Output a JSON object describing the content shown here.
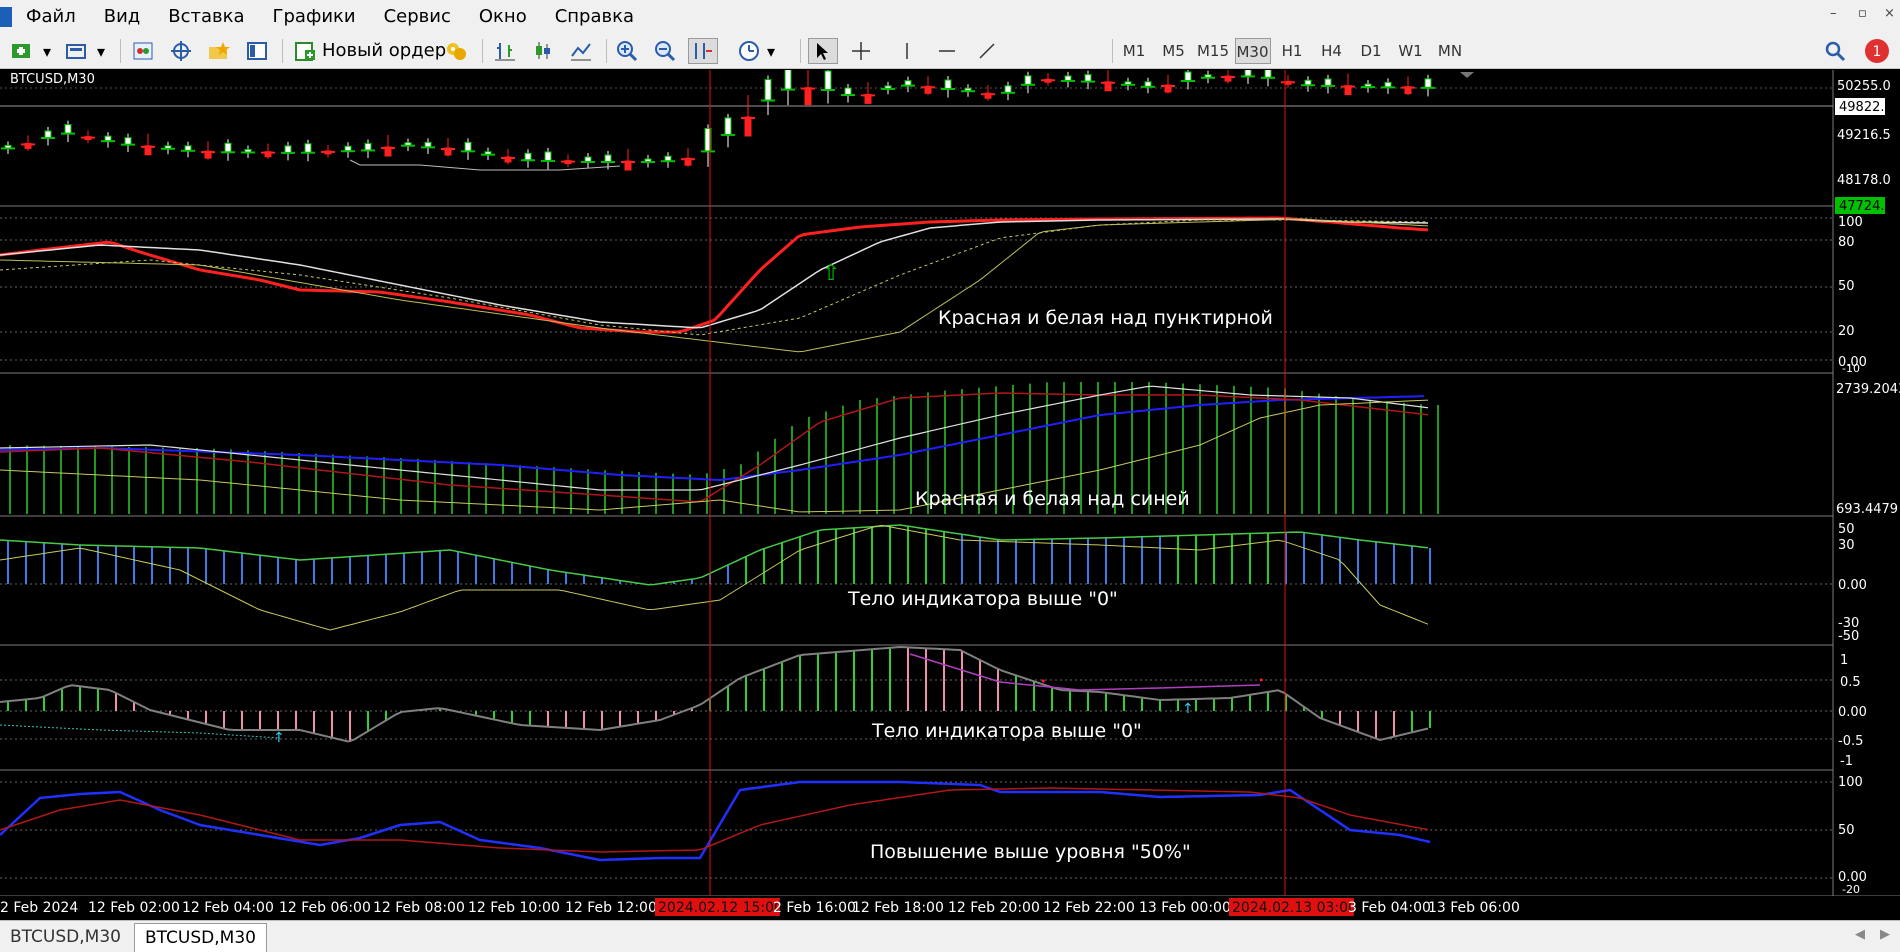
{
  "menu": [
    "Файл",
    "Вид",
    "Вставка",
    "Графики",
    "Сервис",
    "Окно",
    "Справка"
  ],
  "window_controls": [
    "–",
    "▫",
    "×"
  ],
  "toolbar": {
    "new_order_label": "Новый ордер",
    "timeframes": [
      "M1",
      "M5",
      "M15",
      "M30",
      "H1",
      "H4",
      "D1",
      "W1",
      "MN"
    ],
    "active_timeframe": "M30",
    "notification_count": "1"
  },
  "chart": {
    "symbol_title": "BTCUSD,M30",
    "price_labels": [
      "50255.0",
      "49822.6",
      "49216.5",
      "48178.0",
      "47724.6"
    ],
    "current_price": "49822.6",
    "bid_price": "47724.6",
    "colors": {
      "up": "#00c000",
      "down": "#ff2020",
      "rsi": "#ff2020",
      "blue": "#2020ff"
    }
  },
  "panes": [
    {
      "name": "stoch",
      "levels": [
        "100",
        "80",
        "50",
        "20",
        "0.00",
        "-10"
      ],
      "annotation": "Красная и белая над пунктирной"
    },
    {
      "name": "macd",
      "levels": [
        "2739.2043",
        "693.4479"
      ],
      "annotation": "Красная и белая над синей"
    },
    {
      "name": "histogram",
      "levels": [
        "50",
        "30",
        "0.00",
        "-30",
        "-50"
      ],
      "annotation": "Тело индикатора выше \"0\""
    },
    {
      "name": "ao",
      "levels": [
        "1",
        "0.5",
        "0.00",
        "-0.5",
        "-1"
      ],
      "annotation": "Тело индикатора выше \"0\""
    },
    {
      "name": "rsi",
      "levels": [
        "100",
        "50",
        "0.00",
        "-20"
      ],
      "annotation": "Повышение выше уровня \"50%\""
    }
  ],
  "time_axis": [
    "2 Feb 2024",
    "12 Feb 02:00",
    "12 Feb 04:00",
    "12 Feb 06:00",
    "12 Feb 08:00",
    "12 Feb 10:00",
    "12 Feb 12:00",
    "2024.02.12 15:00",
    "2 Feb 16:00",
    "12 Feb 18:00",
    "12 Feb 20:00",
    "12 Feb 22:00",
    "13 Feb 00:00",
    "2024.02.13 03:00",
    "3 Feb 04:00",
    "13 Feb 06:00"
  ],
  "time_markers": [
    "2024.02.12 15:00",
    "2024.02.13 03:00"
  ],
  "tabs": [
    "BTCUSD,M30",
    "BTCUSD,M30"
  ],
  "active_tab": 1
}
